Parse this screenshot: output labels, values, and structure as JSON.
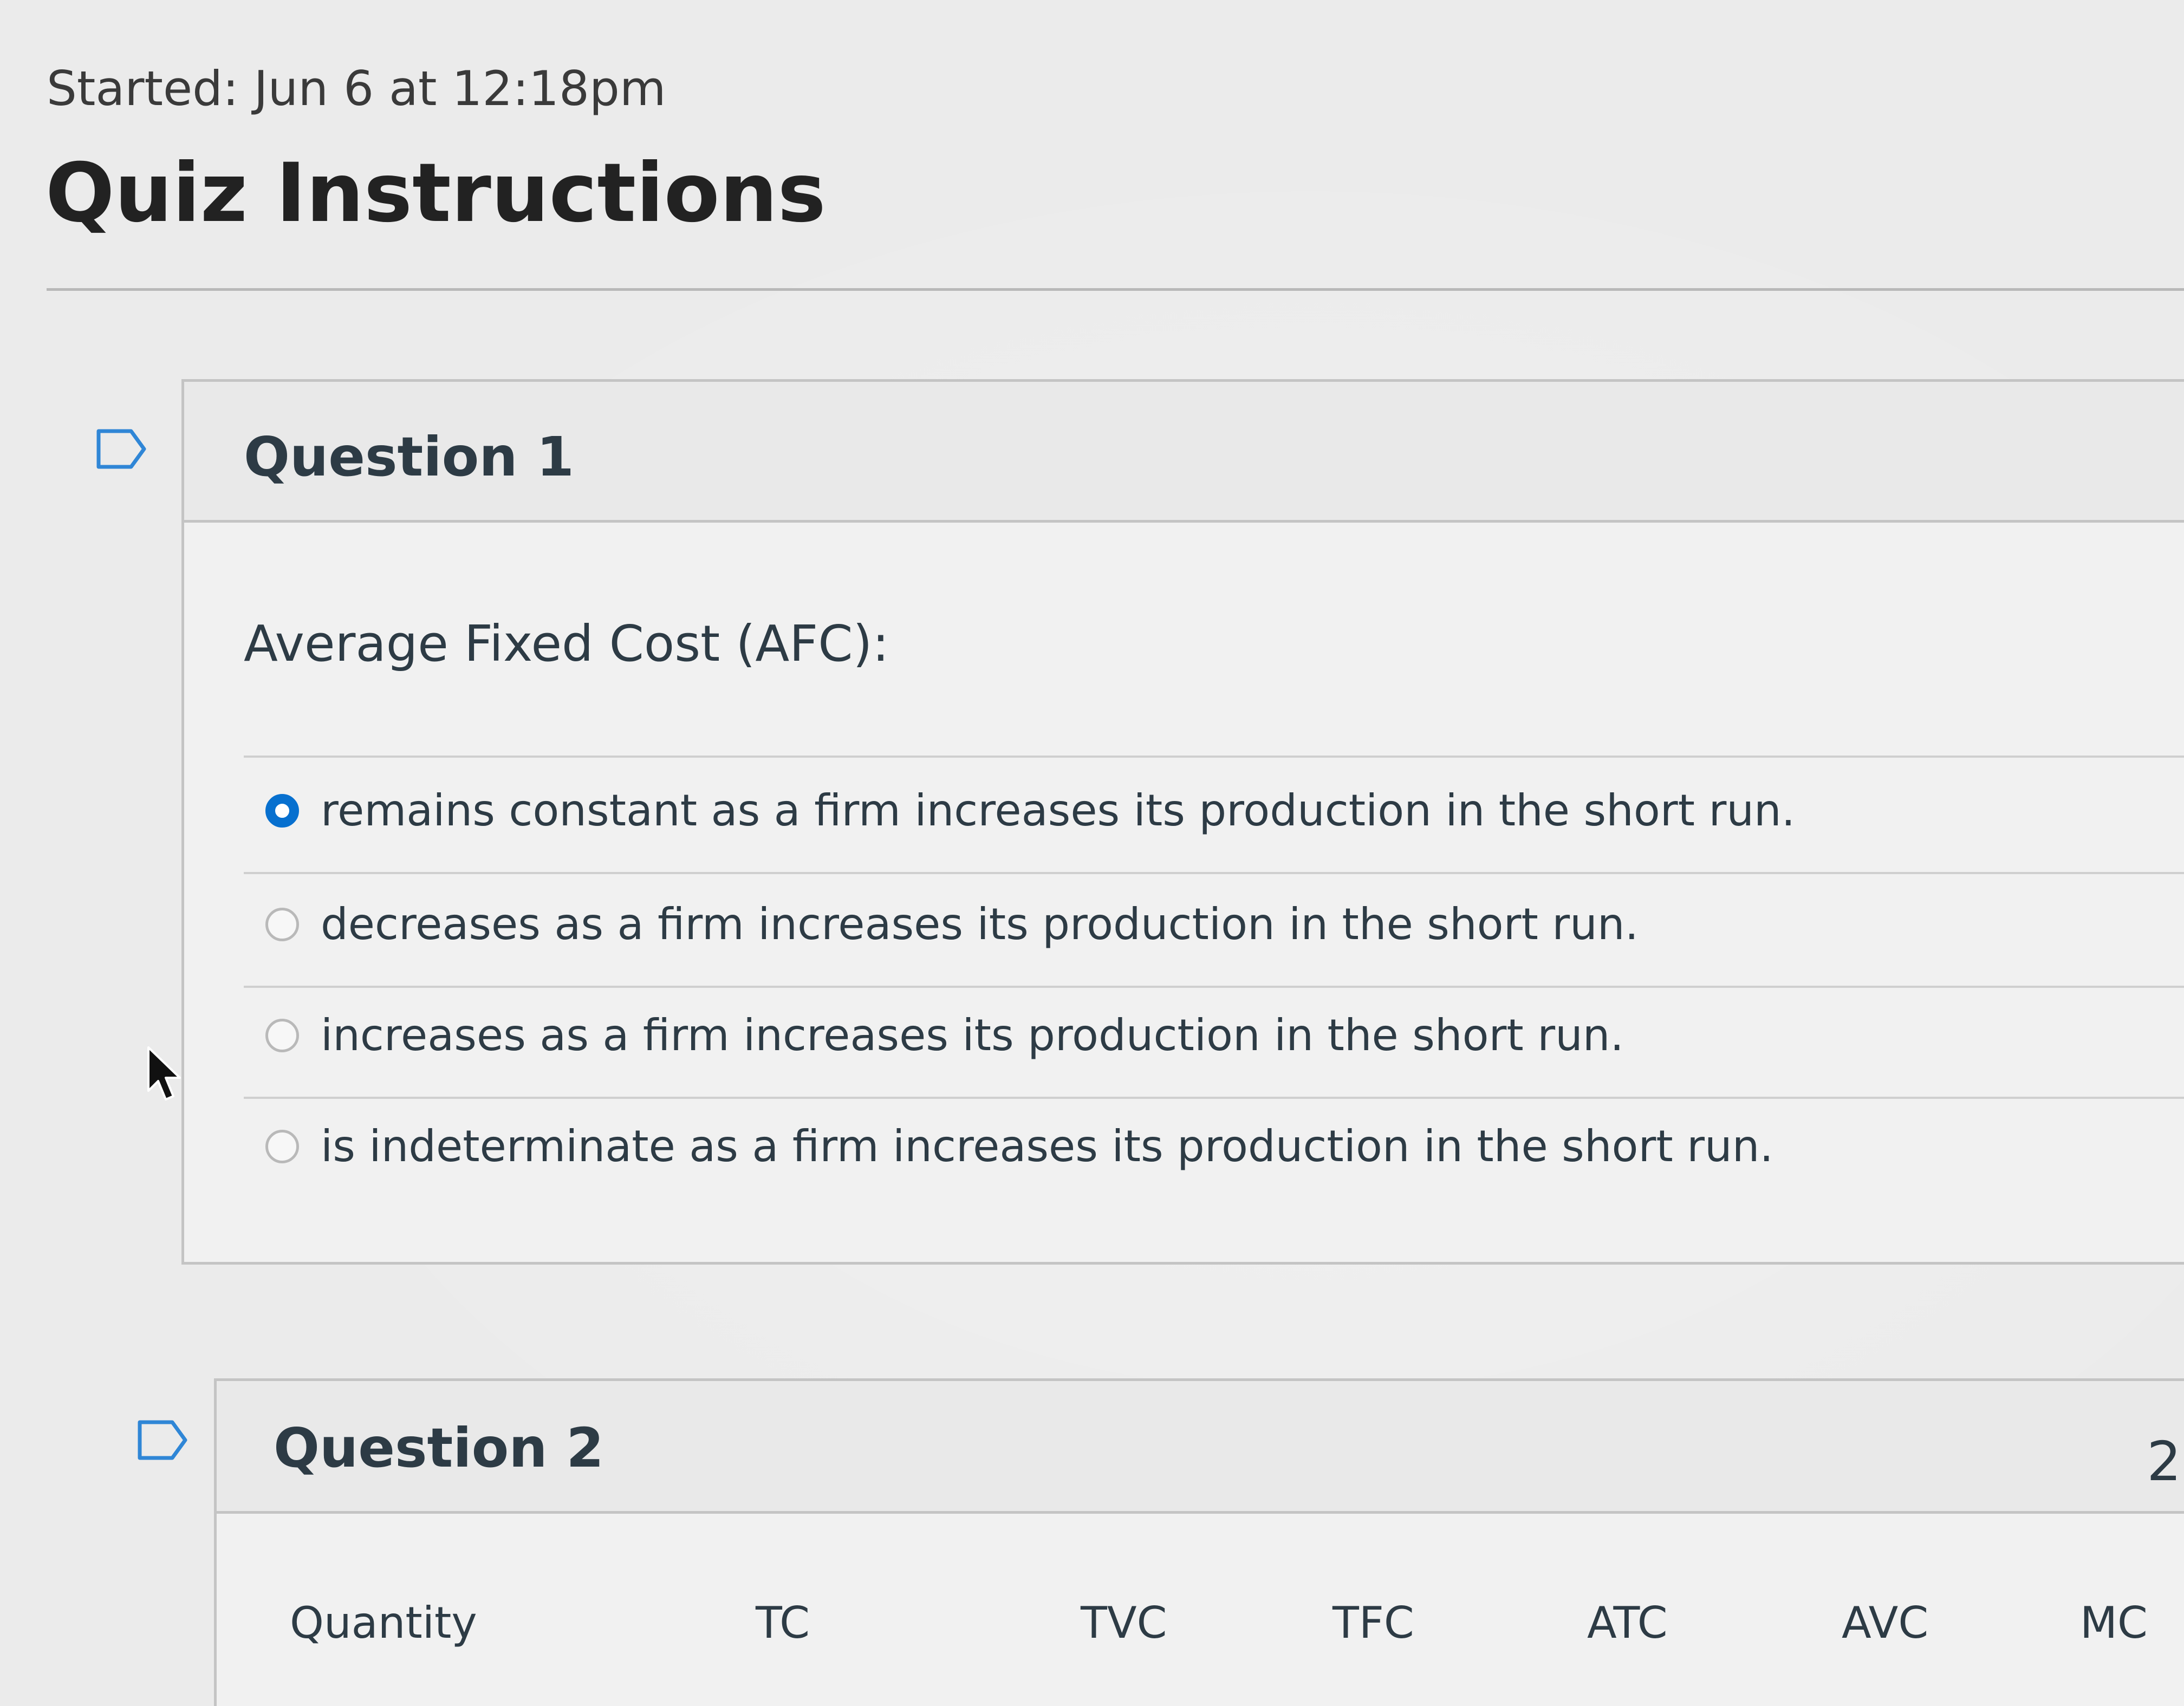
{
  "header": {
    "started_text": "Started: Jun 6 at 12:18pm",
    "title": "Quiz Instructions"
  },
  "questions": [
    {
      "title": "Question 1",
      "text": "Average Fixed Cost (AFC):",
      "selected_index": 0,
      "answers": [
        "remains constant as a firm increases its production in the short run.",
        "decreases as a firm increases its production in the short run.",
        "increases as a firm increases its production in the short run.",
        "is indeterminate as a firm increases its production in the short run."
      ]
    },
    {
      "title": "Question 2",
      "points_partial": "2",
      "table_headers": [
        "Quantity",
        "TC",
        "TVC",
        "TFC",
        "ATC",
        "AVC",
        "MC"
      ]
    }
  ],
  "colors": {
    "radio_selected": "#0770cf",
    "text": "#2d3b45",
    "border": "#c4c4c4"
  },
  "icons": {
    "flag": "flag-question-icon",
    "cursor": "mouse-pointer-icon"
  }
}
